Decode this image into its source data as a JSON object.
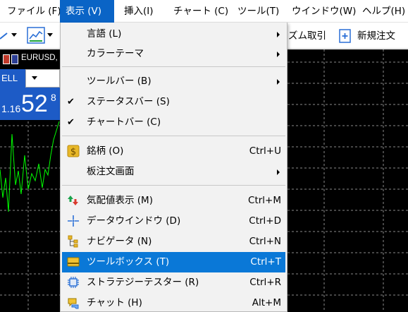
{
  "menubar": {
    "file": "ファイル (F)",
    "view": "表示 (V)",
    "insert": "挿入(I)",
    "chart": "チャート (C)",
    "tools": "ツール(T)",
    "window": "ウインドウ(W)",
    "help": "ヘルプ(H)"
  },
  "toolbar": {
    "algo_trading": "ズム取引",
    "new_order": "新規注文"
  },
  "trade_panel": {
    "symbol": "EURUSD,",
    "sell": "ELL",
    "price_prefix": "1.16",
    "price_big": "52",
    "price_sup": "8"
  },
  "view_menu": {
    "language": "言語 (L)",
    "color_theme": "カラーテーマ",
    "toolbar": "ツールバー (B)",
    "status_bar": "ステータスバー (S)",
    "chart_bar": "チャートバー (C)",
    "symbols": "銘柄 (O)",
    "symbols_shortcut": "Ctrl+U",
    "depth_of_market": "板注文画面",
    "market_watch": "気配値表示 (M)",
    "market_watch_shortcut": "Ctrl+M",
    "data_window": "データウインドウ (D)",
    "data_window_shortcut": "Ctrl+D",
    "navigator": "ナビゲータ (N)",
    "navigator_shortcut": "Ctrl+N",
    "toolbox": "ツールボックス (T)",
    "toolbox_shortcut": "Ctrl+T",
    "strategy_tester": "ストラテジーテスター (R)",
    "strategy_tester_shortcut": "Ctrl+R",
    "chat": "チャット (H)",
    "chat_shortcut": "Alt+M"
  },
  "colors": {
    "menu_active": "#0a64c6",
    "menu_highlight": "#0a78d7",
    "chart_bg": "#000000",
    "chart_line": "#00ff00",
    "sell_blue": "#1d5bc6"
  }
}
